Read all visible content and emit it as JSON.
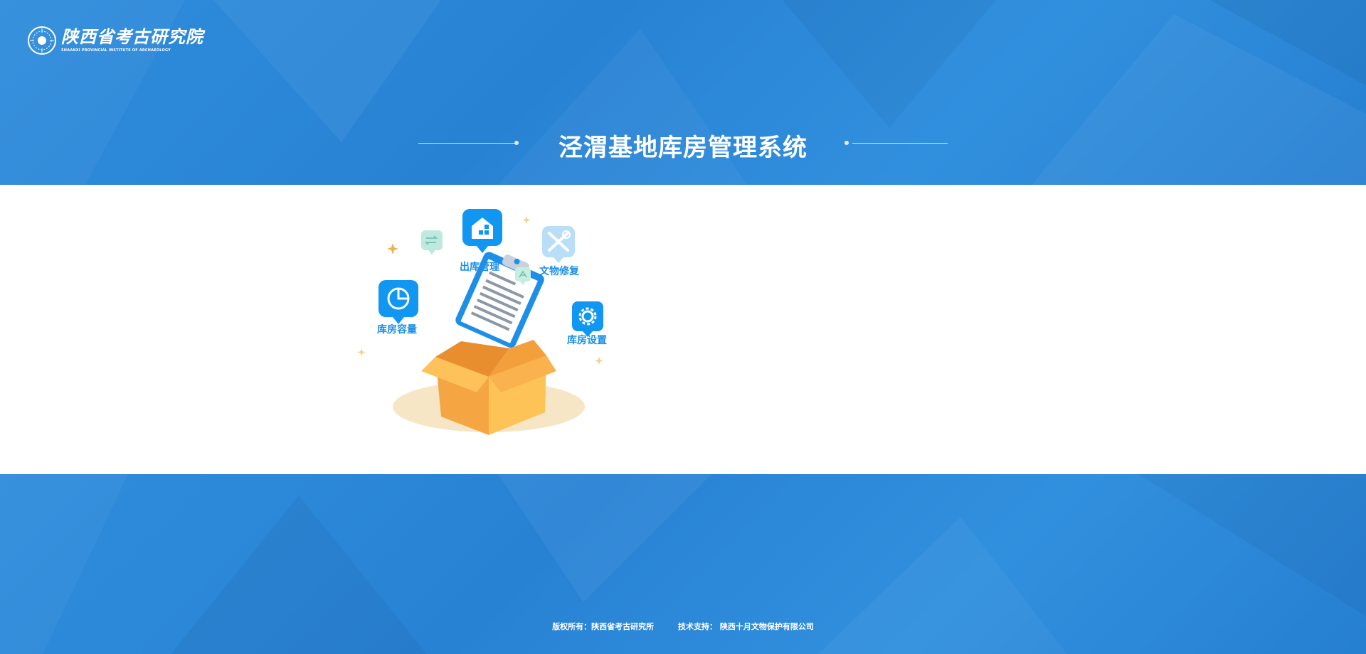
{
  "header": {
    "logo_cn": "陕西省考古研究院",
    "logo_en": "SHAANXI PROVINCIAL INSTITUTE OF ARCHAEOLOGY",
    "title": "泾渭基地库房管理系统"
  },
  "illustration": {
    "items": [
      {
        "label": "出库管理",
        "icon": "warehouse-out-icon"
      },
      {
        "label": "文物修复",
        "icon": "repair-tools-icon"
      },
      {
        "label": "库房容量",
        "icon": "pie-chart-icon"
      },
      {
        "label": "库房设置",
        "icon": "gear-icon"
      }
    ]
  },
  "footer": {
    "copyright": "版权所有：陕西省考古研究所",
    "support": "技术支持：  陕西十月文物保护有限公司"
  },
  "colors": {
    "background": "#2a86d6",
    "accent": "#1b8fe6",
    "box": "#f7a93c"
  }
}
